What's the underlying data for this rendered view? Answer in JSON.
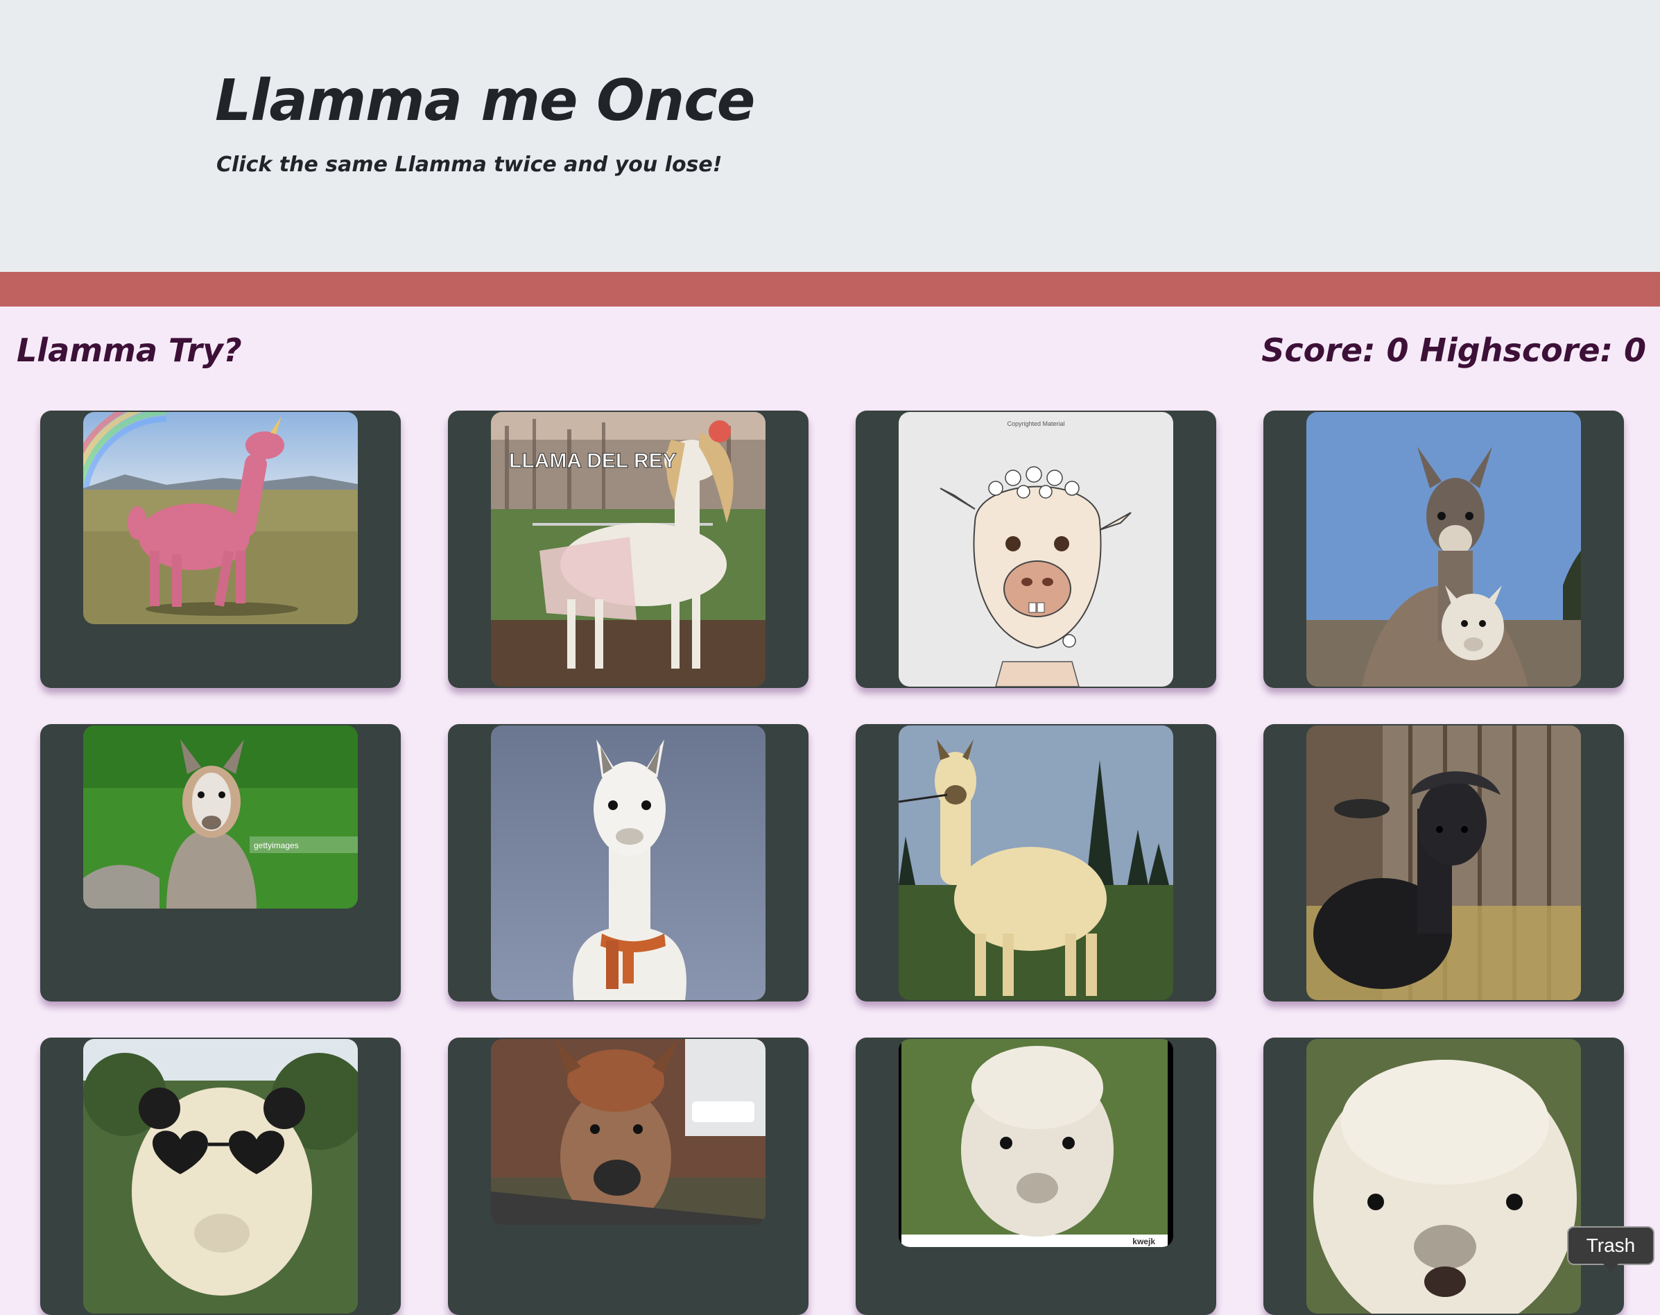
{
  "header": {
    "title": "Llamma me Once",
    "subtitle": "Click the same Llamma twice and you lose!"
  },
  "nav": {
    "left_text": "Llamma Try?",
    "score_text": "Score: 0 Highscore: 0",
    "score": 0,
    "highscore": 0
  },
  "colors": {
    "jumbotron": "#e9ecef",
    "band": "#c0625f",
    "page_background": "#f6eaf8",
    "card_background": "#384240",
    "nav_text": "#3d1038"
  },
  "cards": [
    {
      "id": 1,
      "alt": "pink unicorn llama with rainbow"
    },
    {
      "id": 2,
      "alt": "llama in dress with wig",
      "caption": "LLAMA DEL REY"
    },
    {
      "id": 3,
      "alt": "drawn llama with flower crown",
      "caption": "Copyrighted Material"
    },
    {
      "id": 4,
      "alt": "two llamas under blue sky"
    },
    {
      "id": 5,
      "alt": "llama in green grass",
      "caption": "gettyimages"
    },
    {
      "id": 6,
      "alt": "white llama with orange scarf"
    },
    {
      "id": 7,
      "alt": "cream llama near pine trees"
    },
    {
      "id": 8,
      "alt": "black alpaca by wooden wall"
    },
    {
      "id": 9,
      "alt": "alpaca wearing heart sunglasses"
    },
    {
      "id": 10,
      "alt": "brown alpaca close-up"
    },
    {
      "id": 11,
      "alt": "white alpaca face",
      "caption": "kwejk"
    },
    {
      "id": 12,
      "alt": "fluffy white alpaca face"
    }
  ],
  "tooltip": {
    "label": "Trash"
  }
}
